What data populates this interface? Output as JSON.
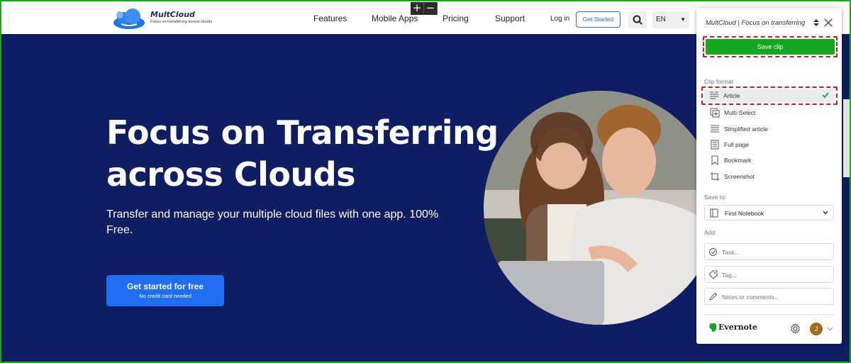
{
  "zoom": {
    "plus": "+",
    "minus": "−"
  },
  "site": {
    "logo_name": "MultCloud",
    "logo_tagline": "Focus on transferring across clouds",
    "nav": [
      "Features",
      "Mobile Apps",
      "Pricing",
      "Support"
    ],
    "login": "Log in",
    "get_started": "Get Started",
    "language": "EN",
    "icons": [
      "cloud-logo-icon",
      "search-icon",
      "chevron-down-icon"
    ]
  },
  "hero": {
    "title": "Focus on Transferring across Clouds",
    "subtitle": "Transfer and manage your multiple cloud files with one app. 100% Free.",
    "cta_label": "Get started for free",
    "cta_note": "No credit card needed",
    "background": "#0f1d62"
  },
  "clipper": {
    "title": "MultCloud | Focus on transferring",
    "save_label": "Save clip",
    "clip_format_label": "Clip format",
    "formats": [
      {
        "label": "Article",
        "icon": "article-icon",
        "selected": true
      },
      {
        "label": "Multi-Select",
        "icon": "multi-select-icon"
      },
      {
        "label": "Simplified article",
        "icon": "simplified-article-icon"
      },
      {
        "label": "Full page",
        "icon": "full-page-icon"
      },
      {
        "label": "Bookmark",
        "icon": "bookmark-icon"
      },
      {
        "label": "Screenshot",
        "icon": "screenshot-icon"
      }
    ],
    "save_to_label": "Save to:",
    "notebook": "First Notebook",
    "add_label": "Add:",
    "task_placeholder": "Task...",
    "tag_placeholder": "Tag...",
    "notes_placeholder": "Notes or comments...",
    "brand": "Evernote",
    "avatar_initial": "J",
    "accent": "#14a821",
    "highlight": "#d81818"
  }
}
